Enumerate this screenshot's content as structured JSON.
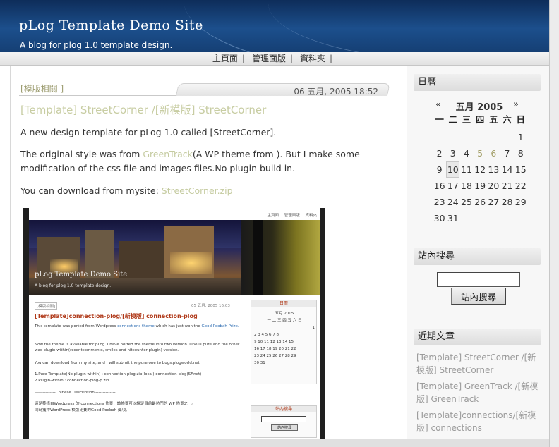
{
  "site": {
    "title": "pLog Template Demo Site",
    "description": "A blog for plog 1.0 template design."
  },
  "nav": {
    "items": [
      {
        "label": "主頁面"
      },
      {
        "label": "管理面版"
      },
      {
        "label": "資料夾"
      }
    ],
    "separator": "|"
  },
  "post": {
    "category": "[模版相關 ]",
    "date": "06 五月, 2005 18:52",
    "title": "[Template] StreetCorner /[新模版] StreetCorner",
    "p1": "A new design template for pLog 1.0 called [StreetCorner].",
    "p2_before": "The original style was from ",
    "p2_link": "GreenTrack",
    "p2_after": "(A WP theme from ). But I make some modification of the css file and images files.No plugin build in.",
    "p3_before": "You can download from mysite: ",
    "p3_link": "StreetCorner.zip"
  },
  "screenshot": {
    "nav": [
      "主頁面",
      "管理面版",
      "資料夾"
    ],
    "title": "pLog Template Demo Site",
    "description": "A blog for plog 1.0 template design.",
    "category": "[模版相關]",
    "date": "05 五月, 2005 16:03",
    "post_title": "[Template]connection-plog/[新模版] connection-plog",
    "p1a": "This template was ported from Wordpress ",
    "p1b": "connections theme",
    "p1c": " which has just won the ",
    "p1d": "Good Poobah Prize.",
    "p2": "Now the theme is available for pLog. I have ported the theme into two version. One is pure and the other was plugin within(recentcomments, smiles and hitcounter plugin) version.",
    "p3": "You can download from my site, and I will submit the pure one to bugs.plogworld.net.",
    "p4a": "1.Pure Template(No plugin within) : connection-plog.zip(local) connection-plog(SF.net)",
    "p4b": "2.Plugin-within : connection-plog-p.zip",
    "p5": "---------------Chinese Description---------------",
    "p6": "這是移植自Wordpress 的 connections 佈景，該佈景可以說是目前最熱門的 WP 佈景之一。",
    "p7": "同時獲得WordPress 模版比賽的Good Poobah 獎項。",
    "side_cal_head": "日曆",
    "side_cal_month": "五月 2005",
    "side_cal_dows": "一 二 三 四 五 六 日",
    "side_cal_rows": [
      "1",
      "2 3 4 5 6 7 8",
      "9 10 11 12 13 14 15",
      "16 17 18 19 20 21 22",
      "23 24 25 26 27 28 29",
      "30 31"
    ],
    "side_search_head": "站內搜尋",
    "side_search_btn": "站內搜尋"
  },
  "sidebar": {
    "calendar": {
      "heading": "日曆",
      "prev": "«",
      "month": "五月 2005",
      "next": "»",
      "dows": [
        "一",
        "二",
        "三",
        "四",
        "五",
        "六",
        "日"
      ],
      "weeks": [
        [
          "",
          "",
          "",
          "",
          "",
          "",
          "1"
        ],
        [
          "2",
          "3",
          "4",
          "5",
          "6",
          "7",
          "8"
        ],
        [
          "9",
          "10",
          "11",
          "12",
          "13",
          "14",
          "15"
        ],
        [
          "16",
          "17",
          "18",
          "19",
          "20",
          "21",
          "22"
        ],
        [
          "23",
          "24",
          "25",
          "26",
          "27",
          "28",
          "29"
        ],
        [
          "30",
          "31",
          "",
          "",
          "",
          "",
          ""
        ]
      ],
      "post_days": [
        "5",
        "6"
      ],
      "today": "10"
    },
    "search": {
      "heading": "站內搜尋",
      "value": "",
      "button": "站內搜尋"
    },
    "recent": {
      "heading": "近期文章",
      "items": [
        "[Template] StreetCorner /[新模版] StreetCorner",
        "[Template] GreenTrack /[新模版] GreenTrack",
        "[Template]connections/[新模版] connections"
      ]
    }
  },
  "colors": {
    "header": "#1c4f8c",
    "link": "#c5cba0",
    "post_day": "#a4a06a",
    "mini_title": "#b03a1a"
  }
}
